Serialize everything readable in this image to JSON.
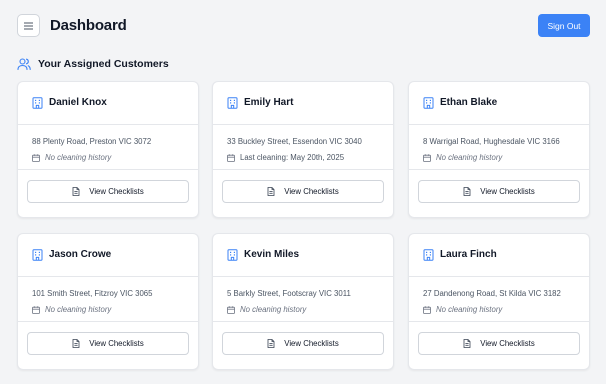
{
  "header": {
    "title": "Dashboard",
    "menu_icon": "hamburger-menu-icon",
    "signout_label": "Sign Out",
    "accent_color": "#3b82f6"
  },
  "section": {
    "title": "Your Assigned Customers",
    "icon": "users-icon"
  },
  "customers": [
    {
      "name": "Daniel Knox",
      "address": "88 Plenty Road, Preston VIC 3072",
      "cleaning": "No cleaning history",
      "has_history": false,
      "button_label": "View Checklists"
    },
    {
      "name": "Emily Hart",
      "address": "33 Buckley Street, Essendon VIC 3040",
      "cleaning": "Last cleaning: May 20th, 2025",
      "has_history": true,
      "button_label": "View Checklists"
    },
    {
      "name": "Ethan Blake",
      "address": "8 Warrigal Road, Hughesdale VIC 3166",
      "cleaning": "No cleaning history",
      "has_history": false,
      "button_label": "View Checklists"
    },
    {
      "name": "Jason Crowe",
      "address": "101 Smith Street, Fitzroy VIC 3065",
      "cleaning": "No cleaning history",
      "has_history": false,
      "button_label": "View Checklists"
    },
    {
      "name": "Kevin Miles",
      "address": "5 Barkly Street, Footscray VIC 3011",
      "cleaning": "No cleaning history",
      "has_history": false,
      "button_label": "View Checklists"
    },
    {
      "name": "Laura Finch",
      "address": "27 Dandenong Road, St Kilda VIC 3182",
      "cleaning": "No cleaning history",
      "has_history": false,
      "button_label": "View Checklists"
    }
  ]
}
